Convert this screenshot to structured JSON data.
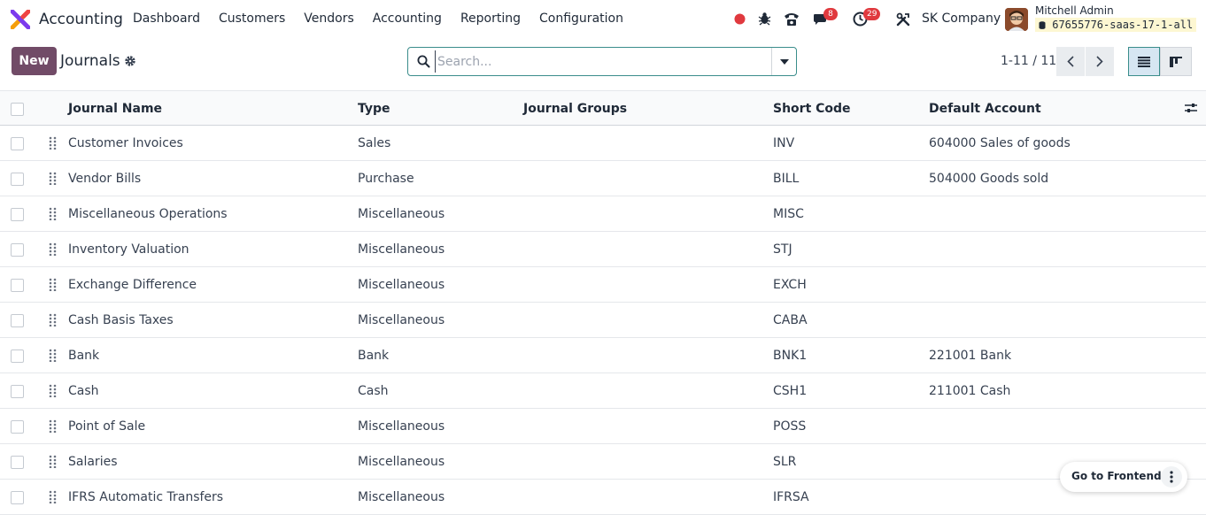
{
  "navbar": {
    "app_name": "Accounting",
    "menu": [
      {
        "label": "Dashboard"
      },
      {
        "label": "Customers"
      },
      {
        "label": "Vendors"
      },
      {
        "label": "Accounting"
      },
      {
        "label": "Reporting"
      },
      {
        "label": "Configuration"
      }
    ],
    "messages_count": "8",
    "activities_count": "29",
    "company": "SK Company",
    "user_name": "Mitchell Admin",
    "database": "67655776-saas-17-1-all",
    "record_color": "#e0393e"
  },
  "control": {
    "new_label": "New",
    "title": "Journals",
    "search_placeholder": "Search...",
    "pager": "1-11 / 11"
  },
  "table": {
    "columns": [
      "Journal Name",
      "Type",
      "Journal Groups",
      "Short Code",
      "Default Account"
    ],
    "rows": [
      {
        "name": "Customer Invoices",
        "type": "Sales",
        "groups": "",
        "code": "INV",
        "account": "604000 Sales of goods"
      },
      {
        "name": "Vendor Bills",
        "type": "Purchase",
        "groups": "",
        "code": "BILL",
        "account": "504000 Goods sold"
      },
      {
        "name": "Miscellaneous Operations",
        "type": "Miscellaneous",
        "groups": "",
        "code": "MISC",
        "account": ""
      },
      {
        "name": "Inventory Valuation",
        "type": "Miscellaneous",
        "groups": "",
        "code": "STJ",
        "account": ""
      },
      {
        "name": "Exchange Difference",
        "type": "Miscellaneous",
        "groups": "",
        "code": "EXCH",
        "account": ""
      },
      {
        "name": "Cash Basis Taxes",
        "type": "Miscellaneous",
        "groups": "",
        "code": "CABA",
        "account": ""
      },
      {
        "name": "Bank",
        "type": "Bank",
        "groups": "",
        "code": "BNK1",
        "account": "221001 Bank"
      },
      {
        "name": "Cash",
        "type": "Cash",
        "groups": "",
        "code": "CSH1",
        "account": "211001 Cash"
      },
      {
        "name": "Point of Sale",
        "type": "Miscellaneous",
        "groups": "",
        "code": "POSS",
        "account": ""
      },
      {
        "name": "Salaries",
        "type": "Miscellaneous",
        "groups": "",
        "code": "SLR",
        "account": ""
      },
      {
        "name": "IFRS Automatic Transfers",
        "type": "Miscellaneous",
        "groups": "",
        "code": "IFRSA",
        "account": ""
      }
    ]
  },
  "floating": {
    "frontend_label": "Go to Frontend"
  },
  "colors": {
    "brand": "#714b67",
    "accent": "#3a8d8b"
  }
}
